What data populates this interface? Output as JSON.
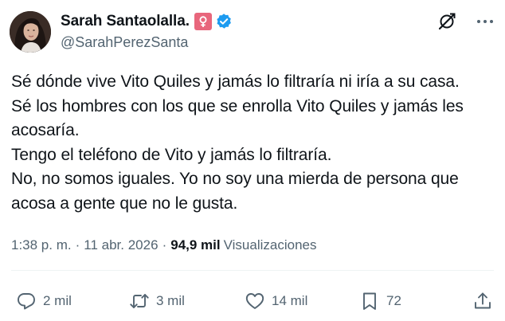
{
  "author": {
    "display_name": "Sarah Santaolalla.",
    "handle": "@SarahPerezSanta",
    "badges": [
      "female-sign-emoji",
      "verified-badge"
    ],
    "avatar_icon": "profile-photo"
  },
  "header_actions": [
    "grok-icon",
    "more-icon"
  ],
  "tweet": {
    "lines": [
      "Sé dónde vive Vito Quiles y jamás lo filtraría ni iría a su casa.",
      "Sé los hombres con los que se enrolla Vito Quiles y jamás les",
      "acosaría.",
      "Tengo el teléfono de Vito y jamás lo filtraría.",
      "No, no somos iguales. Yo no soy una mierda de persona que",
      "acosa a gente que no le gusta."
    ]
  },
  "meta": {
    "time": "1:38 p. m.",
    "separator": "·",
    "date": "11 abr. 2026",
    "views_count": "94,9 mil",
    "views_label": "Visualizaciones"
  },
  "actions": {
    "replies": "2 mil",
    "reposts": "3 mil",
    "likes": "14 mil",
    "bookmarks": "72"
  },
  "colors": {
    "text": "#0f1419",
    "secondary": "#536471",
    "verified": "#1d9bf0",
    "emoji_badge": "#e8667c"
  }
}
